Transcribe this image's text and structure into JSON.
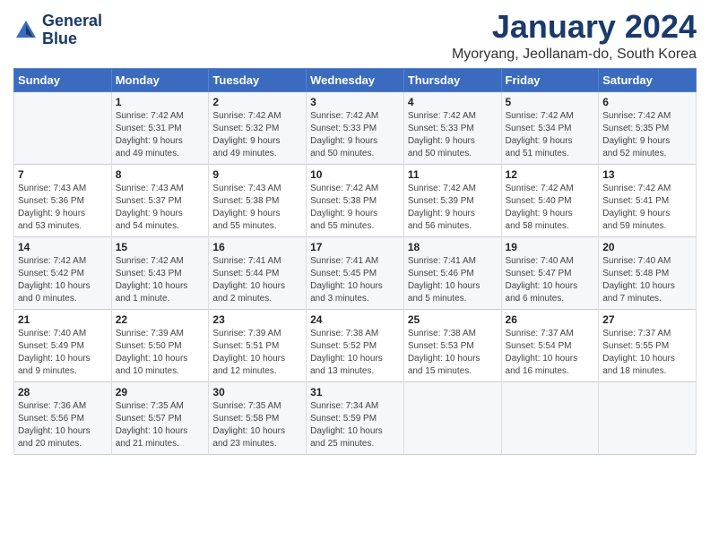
{
  "header": {
    "logo_line1": "General",
    "logo_line2": "Blue",
    "title": "January 2024",
    "subtitle": "Myoryang, Jeollanam-do, South Korea"
  },
  "weekdays": [
    "Sunday",
    "Monday",
    "Tuesday",
    "Wednesday",
    "Thursday",
    "Friday",
    "Saturday"
  ],
  "weeks": [
    [
      {
        "num": "",
        "info": ""
      },
      {
        "num": "1",
        "info": "Sunrise: 7:42 AM\nSunset: 5:31 PM\nDaylight: 9 hours\nand 49 minutes."
      },
      {
        "num": "2",
        "info": "Sunrise: 7:42 AM\nSunset: 5:32 PM\nDaylight: 9 hours\nand 49 minutes."
      },
      {
        "num": "3",
        "info": "Sunrise: 7:42 AM\nSunset: 5:33 PM\nDaylight: 9 hours\nand 50 minutes."
      },
      {
        "num": "4",
        "info": "Sunrise: 7:42 AM\nSunset: 5:33 PM\nDaylight: 9 hours\nand 50 minutes."
      },
      {
        "num": "5",
        "info": "Sunrise: 7:42 AM\nSunset: 5:34 PM\nDaylight: 9 hours\nand 51 minutes."
      },
      {
        "num": "6",
        "info": "Sunrise: 7:42 AM\nSunset: 5:35 PM\nDaylight: 9 hours\nand 52 minutes."
      }
    ],
    [
      {
        "num": "7",
        "info": "Sunrise: 7:43 AM\nSunset: 5:36 PM\nDaylight: 9 hours\nand 53 minutes."
      },
      {
        "num": "8",
        "info": "Sunrise: 7:43 AM\nSunset: 5:37 PM\nDaylight: 9 hours\nand 54 minutes."
      },
      {
        "num": "9",
        "info": "Sunrise: 7:43 AM\nSunset: 5:38 PM\nDaylight: 9 hours\nand 55 minutes."
      },
      {
        "num": "10",
        "info": "Sunrise: 7:42 AM\nSunset: 5:38 PM\nDaylight: 9 hours\nand 55 minutes."
      },
      {
        "num": "11",
        "info": "Sunrise: 7:42 AM\nSunset: 5:39 PM\nDaylight: 9 hours\nand 56 minutes."
      },
      {
        "num": "12",
        "info": "Sunrise: 7:42 AM\nSunset: 5:40 PM\nDaylight: 9 hours\nand 58 minutes."
      },
      {
        "num": "13",
        "info": "Sunrise: 7:42 AM\nSunset: 5:41 PM\nDaylight: 9 hours\nand 59 minutes."
      }
    ],
    [
      {
        "num": "14",
        "info": "Sunrise: 7:42 AM\nSunset: 5:42 PM\nDaylight: 10 hours\nand 0 minutes."
      },
      {
        "num": "15",
        "info": "Sunrise: 7:42 AM\nSunset: 5:43 PM\nDaylight: 10 hours\nand 1 minute."
      },
      {
        "num": "16",
        "info": "Sunrise: 7:41 AM\nSunset: 5:44 PM\nDaylight: 10 hours\nand 2 minutes."
      },
      {
        "num": "17",
        "info": "Sunrise: 7:41 AM\nSunset: 5:45 PM\nDaylight: 10 hours\nand 3 minutes."
      },
      {
        "num": "18",
        "info": "Sunrise: 7:41 AM\nSunset: 5:46 PM\nDaylight: 10 hours\nand 5 minutes."
      },
      {
        "num": "19",
        "info": "Sunrise: 7:40 AM\nSunset: 5:47 PM\nDaylight: 10 hours\nand 6 minutes."
      },
      {
        "num": "20",
        "info": "Sunrise: 7:40 AM\nSunset: 5:48 PM\nDaylight: 10 hours\nand 7 minutes."
      }
    ],
    [
      {
        "num": "21",
        "info": "Sunrise: 7:40 AM\nSunset: 5:49 PM\nDaylight: 10 hours\nand 9 minutes."
      },
      {
        "num": "22",
        "info": "Sunrise: 7:39 AM\nSunset: 5:50 PM\nDaylight: 10 hours\nand 10 minutes."
      },
      {
        "num": "23",
        "info": "Sunrise: 7:39 AM\nSunset: 5:51 PM\nDaylight: 10 hours\nand 12 minutes."
      },
      {
        "num": "24",
        "info": "Sunrise: 7:38 AM\nSunset: 5:52 PM\nDaylight: 10 hours\nand 13 minutes."
      },
      {
        "num": "25",
        "info": "Sunrise: 7:38 AM\nSunset: 5:53 PM\nDaylight: 10 hours\nand 15 minutes."
      },
      {
        "num": "26",
        "info": "Sunrise: 7:37 AM\nSunset: 5:54 PM\nDaylight: 10 hours\nand 16 minutes."
      },
      {
        "num": "27",
        "info": "Sunrise: 7:37 AM\nSunset: 5:55 PM\nDaylight: 10 hours\nand 18 minutes."
      }
    ],
    [
      {
        "num": "28",
        "info": "Sunrise: 7:36 AM\nSunset: 5:56 PM\nDaylight: 10 hours\nand 20 minutes."
      },
      {
        "num": "29",
        "info": "Sunrise: 7:35 AM\nSunset: 5:57 PM\nDaylight: 10 hours\nand 21 minutes."
      },
      {
        "num": "30",
        "info": "Sunrise: 7:35 AM\nSunset: 5:58 PM\nDaylight: 10 hours\nand 23 minutes."
      },
      {
        "num": "31",
        "info": "Sunrise: 7:34 AM\nSunset: 5:59 PM\nDaylight: 10 hours\nand 25 minutes."
      },
      {
        "num": "",
        "info": ""
      },
      {
        "num": "",
        "info": ""
      },
      {
        "num": "",
        "info": ""
      }
    ]
  ]
}
